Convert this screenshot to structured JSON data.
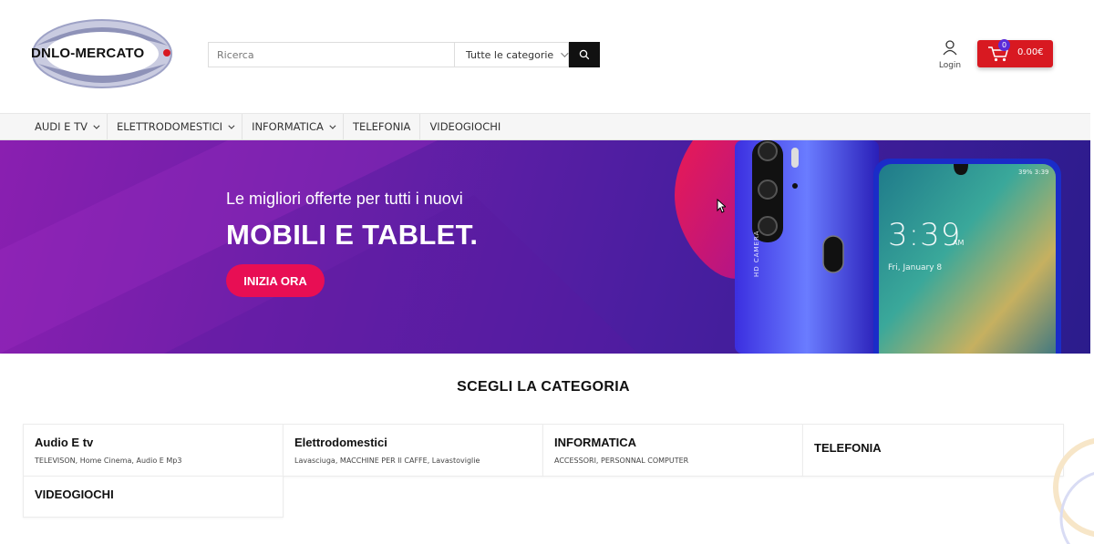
{
  "header": {
    "logo_text": "DNLO-MERCATO",
    "search": {
      "placeholder": "Ricerca",
      "category": "Tutte le categorie"
    },
    "login_label": "Login",
    "cart": {
      "count": "0",
      "total": "0.00€"
    },
    "icons": {
      "search": "search-icon",
      "user": "user-icon",
      "cart": "cart-icon"
    }
  },
  "nav": {
    "items": [
      {
        "label": "AUDI E TV",
        "has_dropdown": true
      },
      {
        "label": "ELETTRODOMESTICI",
        "has_dropdown": true
      },
      {
        "label": "INFORMATICA",
        "has_dropdown": true
      },
      {
        "label": "TELEFONIA",
        "has_dropdown": false
      },
      {
        "label": "VIDEOGIOCHI",
        "has_dropdown": false
      }
    ]
  },
  "banner": {
    "subtitle": "Le migliori offerte per tutti i nuovi",
    "title": "MOBILI E TABLET.",
    "cta": "INIZIA ORA",
    "phone": {
      "time": "3:39",
      "ampm": "AM",
      "date": "Fri, January 8",
      "status": "39% 3:39",
      "camera_label": "HD CAMERA"
    }
  },
  "categories": {
    "title": "SCEGLI LA CATEGORIA",
    "items": [
      {
        "name": "Audio E tv",
        "desc": "TELEVISON, Home Cinema, Audio E Mp3"
      },
      {
        "name": "Elettrodomestici",
        "desc": "Lavasciuga, MACCHINE PER Il CAFFE, Lavastoviglie"
      },
      {
        "name": "INFORMATICA",
        "desc": "ACCESSORI, PERSONNAL COMPUTER"
      },
      {
        "name": "TELEFONIA",
        "desc": ""
      },
      {
        "name": "VIDEOGIOCHI",
        "desc": ""
      }
    ]
  },
  "colors": {
    "accent_red": "#d81921",
    "cta_pink": "#e80e54",
    "badge_purple": "#5b2bd8",
    "banner_purple": "#6a1fa8"
  }
}
